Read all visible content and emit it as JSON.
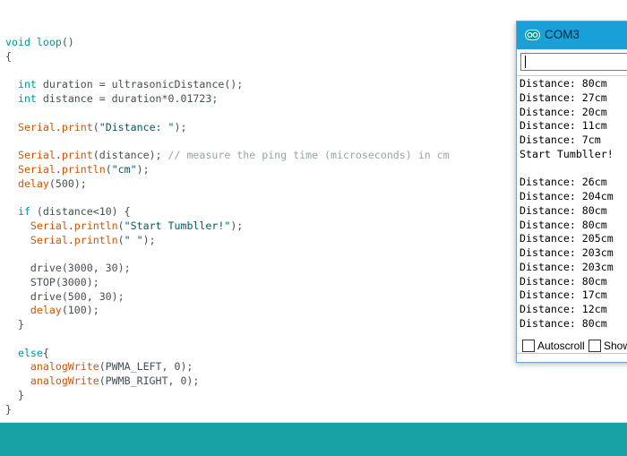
{
  "editor": {
    "lines": [
      [
        {
          "t": "void loop",
          "c": "kw"
        },
        {
          "t": "()",
          "c": ""
        }
      ],
      [
        {
          "t": "{",
          "c": ""
        }
      ],
      [
        {
          "t": "",
          "c": ""
        }
      ],
      [
        {
          "t": "  ",
          "c": ""
        },
        {
          "t": "int",
          "c": "kw"
        },
        {
          "t": " duration = ultrasonicDistance();",
          "c": ""
        }
      ],
      [
        {
          "t": "  ",
          "c": ""
        },
        {
          "t": "int",
          "c": "kw"
        },
        {
          "t": " distance = duration*0.01723;",
          "c": ""
        }
      ],
      [
        {
          "t": "",
          "c": ""
        }
      ],
      [
        {
          "t": "  ",
          "c": ""
        },
        {
          "t": "Serial",
          "c": "fn"
        },
        {
          "t": ".",
          "c": ""
        },
        {
          "t": "print",
          "c": "fn"
        },
        {
          "t": "(",
          "c": ""
        },
        {
          "t": "\"Distance: \"",
          "c": "str"
        },
        {
          "t": ");",
          "c": ""
        }
      ],
      [
        {
          "t": "",
          "c": ""
        }
      ],
      [
        {
          "t": "  ",
          "c": ""
        },
        {
          "t": "Serial",
          "c": "fn"
        },
        {
          "t": ".",
          "c": ""
        },
        {
          "t": "print",
          "c": "fn"
        },
        {
          "t": "(distance); ",
          "c": ""
        },
        {
          "t": "// measure the ping time (microseconds) in cm",
          "c": "cm"
        }
      ],
      [
        {
          "t": "  ",
          "c": ""
        },
        {
          "t": "Serial",
          "c": "fn"
        },
        {
          "t": ".",
          "c": ""
        },
        {
          "t": "println",
          "c": "fn"
        },
        {
          "t": "(",
          "c": ""
        },
        {
          "t": "\"cm\"",
          "c": "str"
        },
        {
          "t": ");",
          "c": ""
        }
      ],
      [
        {
          "t": "  ",
          "c": ""
        },
        {
          "t": "delay",
          "c": "fn"
        },
        {
          "t": "(500);",
          "c": ""
        }
      ],
      [
        {
          "t": "",
          "c": ""
        }
      ],
      [
        {
          "t": "  ",
          "c": ""
        },
        {
          "t": "if",
          "c": "kw"
        },
        {
          "t": " (distance<10) {",
          "c": ""
        }
      ],
      [
        {
          "t": "    ",
          "c": ""
        },
        {
          "t": "Serial",
          "c": "fn"
        },
        {
          "t": ".",
          "c": ""
        },
        {
          "t": "println",
          "c": "fn"
        },
        {
          "t": "(",
          "c": ""
        },
        {
          "t": "\"Start Tumbller!\"",
          "c": "str"
        },
        {
          "t": ");",
          "c": ""
        }
      ],
      [
        {
          "t": "    ",
          "c": ""
        },
        {
          "t": "Serial",
          "c": "fn"
        },
        {
          "t": ".",
          "c": ""
        },
        {
          "t": "println",
          "c": "fn"
        },
        {
          "t": "(",
          "c": ""
        },
        {
          "t": "\" \"",
          "c": "str"
        },
        {
          "t": ");",
          "c": ""
        }
      ],
      [
        {
          "t": "",
          "c": ""
        }
      ],
      [
        {
          "t": "    drive(3000, 30);",
          "c": ""
        }
      ],
      [
        {
          "t": "    STOP(3000);",
          "c": ""
        }
      ],
      [
        {
          "t": "    drive(500, 30);",
          "c": ""
        }
      ],
      [
        {
          "t": "    ",
          "c": ""
        },
        {
          "t": "delay",
          "c": "fn"
        },
        {
          "t": "(100);",
          "c": ""
        }
      ],
      [
        {
          "t": "  }",
          "c": ""
        }
      ],
      [
        {
          "t": "",
          "c": ""
        }
      ],
      [
        {
          "t": "  ",
          "c": ""
        },
        {
          "t": "else",
          "c": "kw"
        },
        {
          "t": "{",
          "c": ""
        }
      ],
      [
        {
          "t": "    ",
          "c": ""
        },
        {
          "t": "analogWrite",
          "c": "fn"
        },
        {
          "t": "(PWMA_LEFT, 0);",
          "c": ""
        }
      ],
      [
        {
          "t": "    ",
          "c": ""
        },
        {
          "t": "analogWrite",
          "c": "fn"
        },
        {
          "t": "(PWMB_RIGHT, 0);",
          "c": ""
        }
      ],
      [
        {
          "t": "  }",
          "c": ""
        }
      ],
      [
        {
          "t": "}",
          "c": ""
        }
      ]
    ]
  },
  "serial_monitor": {
    "title": "COM3",
    "input_value": "",
    "output_lines": [
      "Distance: 80cm",
      "Distance: 27cm",
      "Distance: 20cm",
      "Distance: 11cm",
      "Distance: 7cm",
      "Start Tumbller!",
      "",
      "Distance: 26cm",
      "Distance: 204cm",
      "Distance: 80cm",
      "Distance: 80cm",
      "Distance: 205cm",
      "Distance: 203cm",
      "Distance: 203cm",
      "Distance: 80cm",
      "Distance: 17cm",
      "Distance: 12cm",
      "Distance: 80cm"
    ],
    "autoscroll_label": "Autoscroll",
    "show_timestamp_label": "Show"
  },
  "colors": {
    "status_bar": "#17a1a5",
    "titlebar": "#1aa0d8",
    "keyword": "#00979c",
    "function": "#d35400"
  },
  "icons": {
    "app_icon": "arduino-icon"
  }
}
